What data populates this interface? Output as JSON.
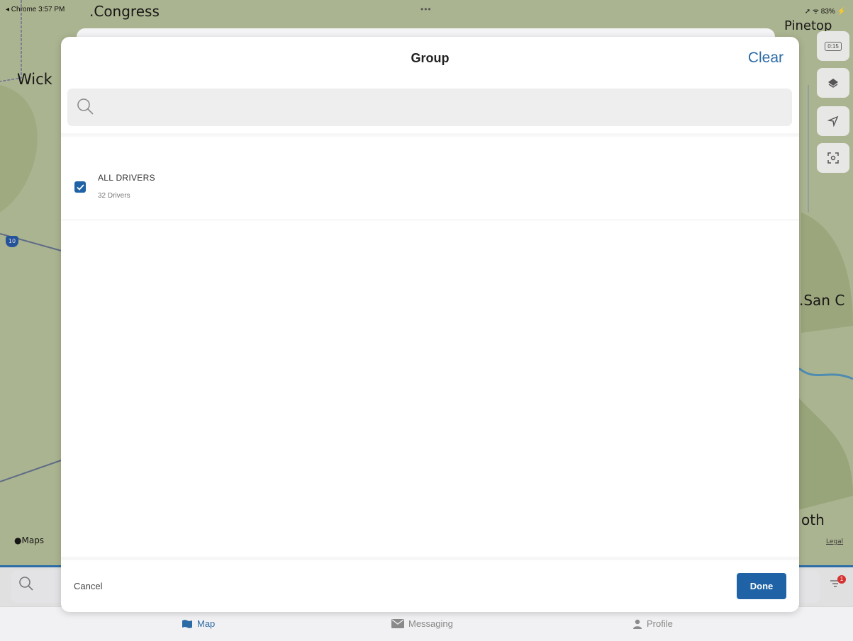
{
  "status_bar": {
    "left": "◂ Chrome  3:57 PM",
    "dots": "•••",
    "right": "➚ ᯤ 83% ⚡"
  },
  "map": {
    "labels": {
      "congress": ".Congress",
      "wick": "Wick",
      "pinetop": "Pinetop",
      "san_c": ".San C",
      "oth": "oth",
      "maps_attribution": "Maps",
      "legal": "Legal",
      "interstate": "10"
    },
    "controls": {
      "timer": "0:15"
    }
  },
  "modal": {
    "title": "Group",
    "clear_label": "Clear",
    "search_placeholder": "",
    "items": [
      {
        "title": "ALL DRIVERS",
        "subtitle": "32 Drivers",
        "checked": true
      }
    ],
    "cancel_label": "Cancel",
    "done_label": "Done"
  },
  "bottom": {
    "filter_badge": "1"
  },
  "tabs": [
    {
      "label": "Map",
      "icon": "map-icon",
      "active": true
    },
    {
      "label": "Messaging",
      "icon": "envelope-icon",
      "active": false
    },
    {
      "label": "Profile",
      "icon": "person-icon",
      "active": false
    }
  ],
  "colors": {
    "accent": "#1f63a6",
    "link": "#2c6aa5",
    "map_bg": "#bfcb9f"
  }
}
